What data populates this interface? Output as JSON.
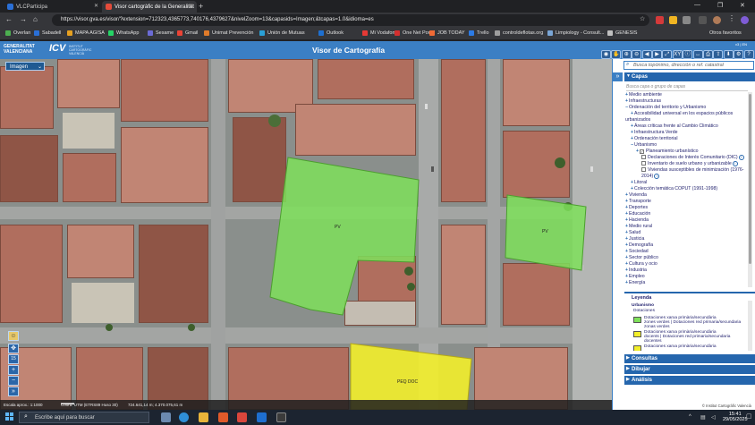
{
  "browser": {
    "tabs": [
      {
        "label": "VLCParticipa",
        "active": false
      },
      {
        "label": "Visor cartogràfic de la Generalitat",
        "active": true
      }
    ],
    "url": "https://visor.gva.es/visor/?extension=712323,4365773,740176,4379627&nivelZoom=13&capasids=Imagen;&tcapas=1.0&idioma=es",
    "bookmarks": [
      "Overlan",
      "Sabadell",
      "MAPA AGISA",
      "WhatsApp",
      "Sesame",
      "Gmail",
      "Unimat Prevención",
      "Unión de Mutuas",
      "Outlook",
      "Mi Vodafone",
      "One Net Portal",
      "JOB TODAY",
      "Trello",
      "controldeflotas.org",
      "Limpiology - Consult...",
      "GENESIS"
    ],
    "other_bookmarks": "Otros favoritos"
  },
  "header": {
    "org_line1": "GENERALITAT",
    "org_line2": "VALENCIANA",
    "icv": "ICV",
    "institute": "INSTITUT CARTOGRÀFIC VALENCIÀ",
    "title": "Visor de Cartografía",
    "toolbar_icons": [
      "view-icon",
      "pan-icon",
      "zoom-in-icon",
      "zoom-out-icon",
      "back-icon",
      "forward-icon",
      "extent-icon",
      "xy-icon",
      "info-icon",
      "measure-icon",
      "print-icon",
      "share-icon",
      "download-icon",
      "settings-icon",
      "help-icon"
    ],
    "xy_label": "XY",
    "version": "v3 | EN"
  },
  "map": {
    "basemap": "Imagen",
    "labels": {
      "pv1": "PV",
      "pv2": "PV",
      "peq": "PEQ DOC"
    },
    "scale": "Escala aprox.: 1:1000",
    "crs": "Coord. UTM (ETRS89 Huso 30)",
    "coords": "724.641,14 m; 4.370.075,61 m",
    "zoom_scale": "15"
  },
  "panel": {
    "search_placeholder": "Busca topónimo, dirección o ref. catastral",
    "layers_title": "Capas",
    "layer_filter_placeholder": "Busca capa o grupo de capas",
    "tree": [
      {
        "label": "Medio ambiente",
        "indent": 0,
        "pm": "+"
      },
      {
        "label": "Infraestructuras",
        "indent": 0,
        "pm": "+"
      },
      {
        "label": "Ordenación del territorio y Urbanismo",
        "indent": 0,
        "pm": "−"
      },
      {
        "label": "Accesibilidad universal en los espacios públicos",
        "indent": 1,
        "pm": "+"
      },
      {
        "label": "urbanizados",
        "indent": 0,
        "pm": ""
      },
      {
        "label": "Áreas críticas frente al Cambio Climático",
        "indent": 1,
        "pm": "+"
      },
      {
        "label": "Infraestructura Verde",
        "indent": 1,
        "pm": "+"
      },
      {
        "label": "Ordenación territorial",
        "indent": 1,
        "pm": "+"
      },
      {
        "label": "Urbanismo",
        "indent": 1,
        "pm": "−"
      },
      {
        "label": "Planeamiento urbanístico",
        "indent": 2,
        "pm": "+",
        "cb": "✓"
      },
      {
        "label": "Declaraciones de Interés Comunitario (DIC)",
        "indent": 3,
        "pm": "",
        "cb": "",
        "info": true
      },
      {
        "label": "Inventario de suelo urbano y urbanizable",
        "indent": 3,
        "pm": "",
        "cb": "",
        "info": true
      },
      {
        "label": "Viviendas susceptibles de minimización (1976-",
        "indent": 3,
        "pm": "",
        "cb": ""
      },
      {
        "label": "2014)",
        "indent": 3,
        "pm": "",
        "info": true
      },
      {
        "label": "Litoral",
        "indent": 1,
        "pm": "+"
      },
      {
        "label": "Colección temática COPUT (1991-1998)",
        "indent": 1,
        "pm": "+"
      },
      {
        "label": "Vivienda",
        "indent": 0,
        "pm": "+"
      },
      {
        "label": "Transporte",
        "indent": 0,
        "pm": "+"
      },
      {
        "label": "Deportes",
        "indent": 0,
        "pm": "+"
      },
      {
        "label": "Educación",
        "indent": 0,
        "pm": "+"
      },
      {
        "label": "Hacienda",
        "indent": 0,
        "pm": "+"
      },
      {
        "label": "Medio rural",
        "indent": 0,
        "pm": "+"
      },
      {
        "label": "Salud",
        "indent": 0,
        "pm": "+"
      },
      {
        "label": "Justicia",
        "indent": 0,
        "pm": "+"
      },
      {
        "label": "Demografía",
        "indent": 0,
        "pm": "+"
      },
      {
        "label": "Sociedad",
        "indent": 0,
        "pm": "+"
      },
      {
        "label": "Sector público",
        "indent": 0,
        "pm": "+"
      },
      {
        "label": "Cultura y ocio",
        "indent": 0,
        "pm": "+"
      },
      {
        "label": "Industria",
        "indent": 0,
        "pm": "+"
      },
      {
        "label": "Empleo",
        "indent": 0,
        "pm": "+"
      },
      {
        "label": "Energía",
        "indent": 0,
        "pm": "+"
      }
    ],
    "legend": {
      "title": "Leyenda",
      "group": "Urbanismo",
      "subgroup": "Dotaciones",
      "items": [
        {
          "line1": "Dotaciones xarxa primària/secundària",
          "line2": "zones verdes | Dotaciones red primaria/secundaria",
          "line3": "zonas verdes",
          "color": "#7ee05a"
        },
        {
          "line1": "Dotaciones xarxa primària/secundària",
          "line2": "docents | Dotaciones red primaria/secundaria",
          "line3": "docentes",
          "color": "#f2ee2a"
        },
        {
          "line1": "Dotaciones xarxa primària/secundària",
          "line2": "",
          "line3": "",
          "color": "#f2ee2a"
        }
      ]
    },
    "sections": [
      "Consultas",
      "Dibujar",
      "Análisis"
    ],
    "attribution": "© Institut Cartogràfic Valencià"
  },
  "taskbar": {
    "search_placeholder": "Escribe aquí para buscar",
    "time": "15:41",
    "date": "29/05/2025"
  },
  "colors": {
    "header_blue": "#3b7fc4",
    "panel_blue": "#2566ad",
    "green_zone": "#7ee05a",
    "yellow_zone": "#f2ee2a"
  }
}
